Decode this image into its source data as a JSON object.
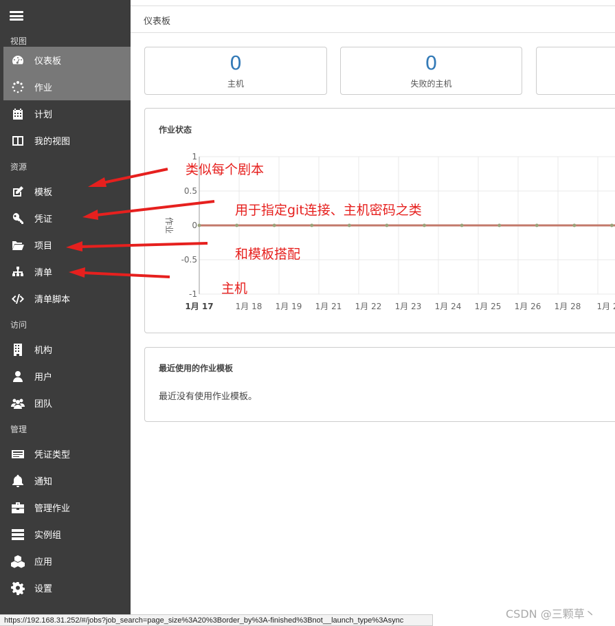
{
  "sidebar": {
    "sections": {
      "view": "视图",
      "resources": "资源",
      "access": "访问",
      "admin": "管理"
    },
    "items": [
      {
        "label": "仪表板",
        "icon": "dashboard-icon"
      },
      {
        "label": "作业",
        "icon": "spinner-icon"
      },
      {
        "label": "计划",
        "icon": "calendar-icon"
      },
      {
        "label": "我的视图",
        "icon": "columns-icon"
      },
      {
        "label": "模板",
        "icon": "edit-icon"
      },
      {
        "label": "凭证",
        "icon": "key-icon"
      },
      {
        "label": "项目",
        "icon": "folder-icon"
      },
      {
        "label": "清单",
        "icon": "sitemap-icon"
      },
      {
        "label": "清单脚本",
        "icon": "code-icon"
      },
      {
        "label": "机构",
        "icon": "building-icon"
      },
      {
        "label": "用户",
        "icon": "user-icon"
      },
      {
        "label": "团队",
        "icon": "users-icon"
      },
      {
        "label": "凭证类型",
        "icon": "id-card-icon"
      },
      {
        "label": "通知",
        "icon": "bell-icon"
      },
      {
        "label": "管理作业",
        "icon": "briefcase-icon"
      },
      {
        "label": "实例组",
        "icon": "server-icon"
      },
      {
        "label": "应用",
        "icon": "cubes-icon"
      },
      {
        "label": "设置",
        "icon": "gear-icon"
      }
    ]
  },
  "header": {
    "breadcrumb": "仪表板"
  },
  "counts": [
    {
      "value": "0",
      "label": "主机"
    },
    {
      "value": "0",
      "label": "失败的主机"
    }
  ],
  "job_status": {
    "title": "作业状态",
    "ylabel": "作业"
  },
  "chart_data": {
    "type": "line",
    "title": "作业状态",
    "ylabel": "作业",
    "ylim": [
      -1,
      1
    ],
    "yticks": [
      "1",
      "0.5",
      "0",
      "-0.5",
      "-1"
    ],
    "categories": [
      "1月 17",
      "1月 18",
      "1月 19",
      "1月 21",
      "1月 22",
      "1月 23",
      "1月 24",
      "1月 25",
      "1月 26",
      "1月 28",
      "1月 2"
    ],
    "series": [
      {
        "values": [
          0,
          0,
          0,
          0,
          0,
          0,
          0,
          0,
          0,
          0,
          0,
          0,
          0
        ],
        "color": "#c2786a"
      }
    ],
    "grid": true
  },
  "recent_templates": {
    "title": "最近使用的作业模板",
    "empty_text": "最近没有使用作业模板。"
  },
  "annotations": [
    "类似每个剧本",
    "用于指定git连接、主机密码之类",
    "和模板搭配",
    "主机"
  ],
  "status_url": "https://192.168.31.252/#/jobs?job_search=page_size%3A20%3Border_by%3A-finished%3Bnot__launch_type%3Async",
  "watermark": "CSDN @三颗草丶",
  "colors": {
    "sidebar_bg": "#3c3c3c",
    "active_bg": "#787878",
    "accent": "#337ab7",
    "annotation": "#e6201e"
  }
}
